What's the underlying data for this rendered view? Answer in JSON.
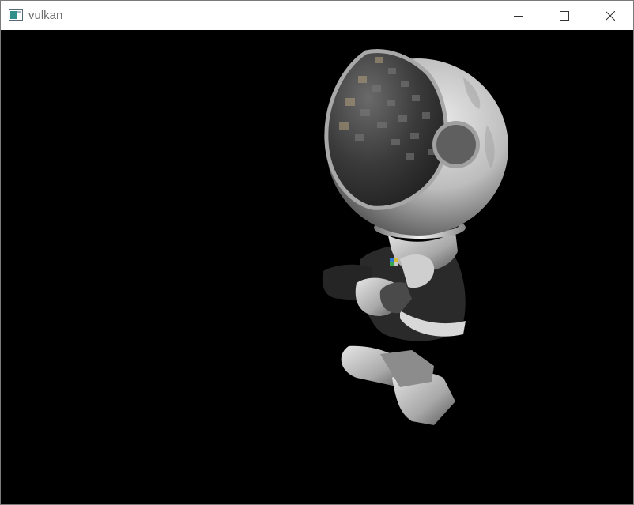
{
  "window": {
    "title": "vulkan",
    "icon": "app-window-icon",
    "controls": {
      "minimize_icon": "minimize-icon",
      "maximize_icon": "maximize-icon",
      "close_icon": "close-icon"
    }
  },
  "viewport": {
    "background": "#000000",
    "scene_object": "astronaut-model"
  }
}
